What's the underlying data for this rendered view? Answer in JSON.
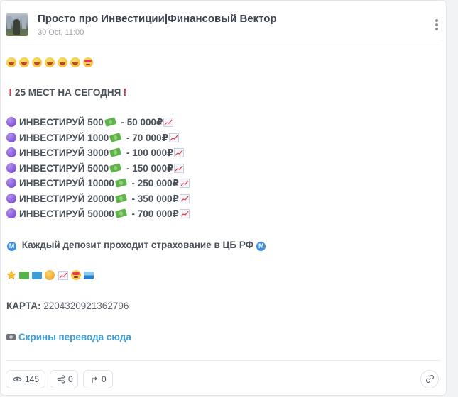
{
  "post": {
    "channel_name": "Просто про Инвестиции|Финансовый Вектор",
    "date": "30 Oct, 11:00"
  },
  "content": {
    "emoji_row_1": [
      "smiley",
      "smiley",
      "smiley",
      "smiley",
      "smiley",
      "smiley",
      "heart-eyes"
    ],
    "headline": "25 МЕСТ НА СЕГОДНЯ",
    "offers": [
      {
        "invest": "ИНВЕСТИРУЙ 500",
        "result": " - 50 000₽"
      },
      {
        "invest": "ИНВЕСТИРУЙ 1000",
        "result": " - 70 000₽"
      },
      {
        "invest": "ИНВЕСТИРУЙ 3000",
        "result": " - 100 000₽"
      },
      {
        "invest": "ИНВЕСТИРУЙ 5000",
        "result": " - 150 000₽"
      },
      {
        "invest": "ИНВЕСТИРУЙ 10000",
        "result": " - 250 000₽"
      },
      {
        "invest": "ИНВЕСТИРУЙ 20000",
        "result": " - 350 000₽"
      },
      {
        "invest": "ИНВЕСТИРУЙ 50000",
        "result": " - 700 000₽"
      }
    ],
    "insurance_text": "Каждый депозит проходит страхование в ЦБ РФ",
    "metro_symbol": "M",
    "card_label": "КАРТА:",
    "card_number": " 2204320921362796",
    "screens_link": "Скрины перевода сюда"
  },
  "footer": {
    "views": "145",
    "shares": "0",
    "forwards": "0"
  },
  "colors": {
    "link": "#3b9fd8",
    "alert": "#e0303d",
    "ball": "#7a4cd6"
  }
}
